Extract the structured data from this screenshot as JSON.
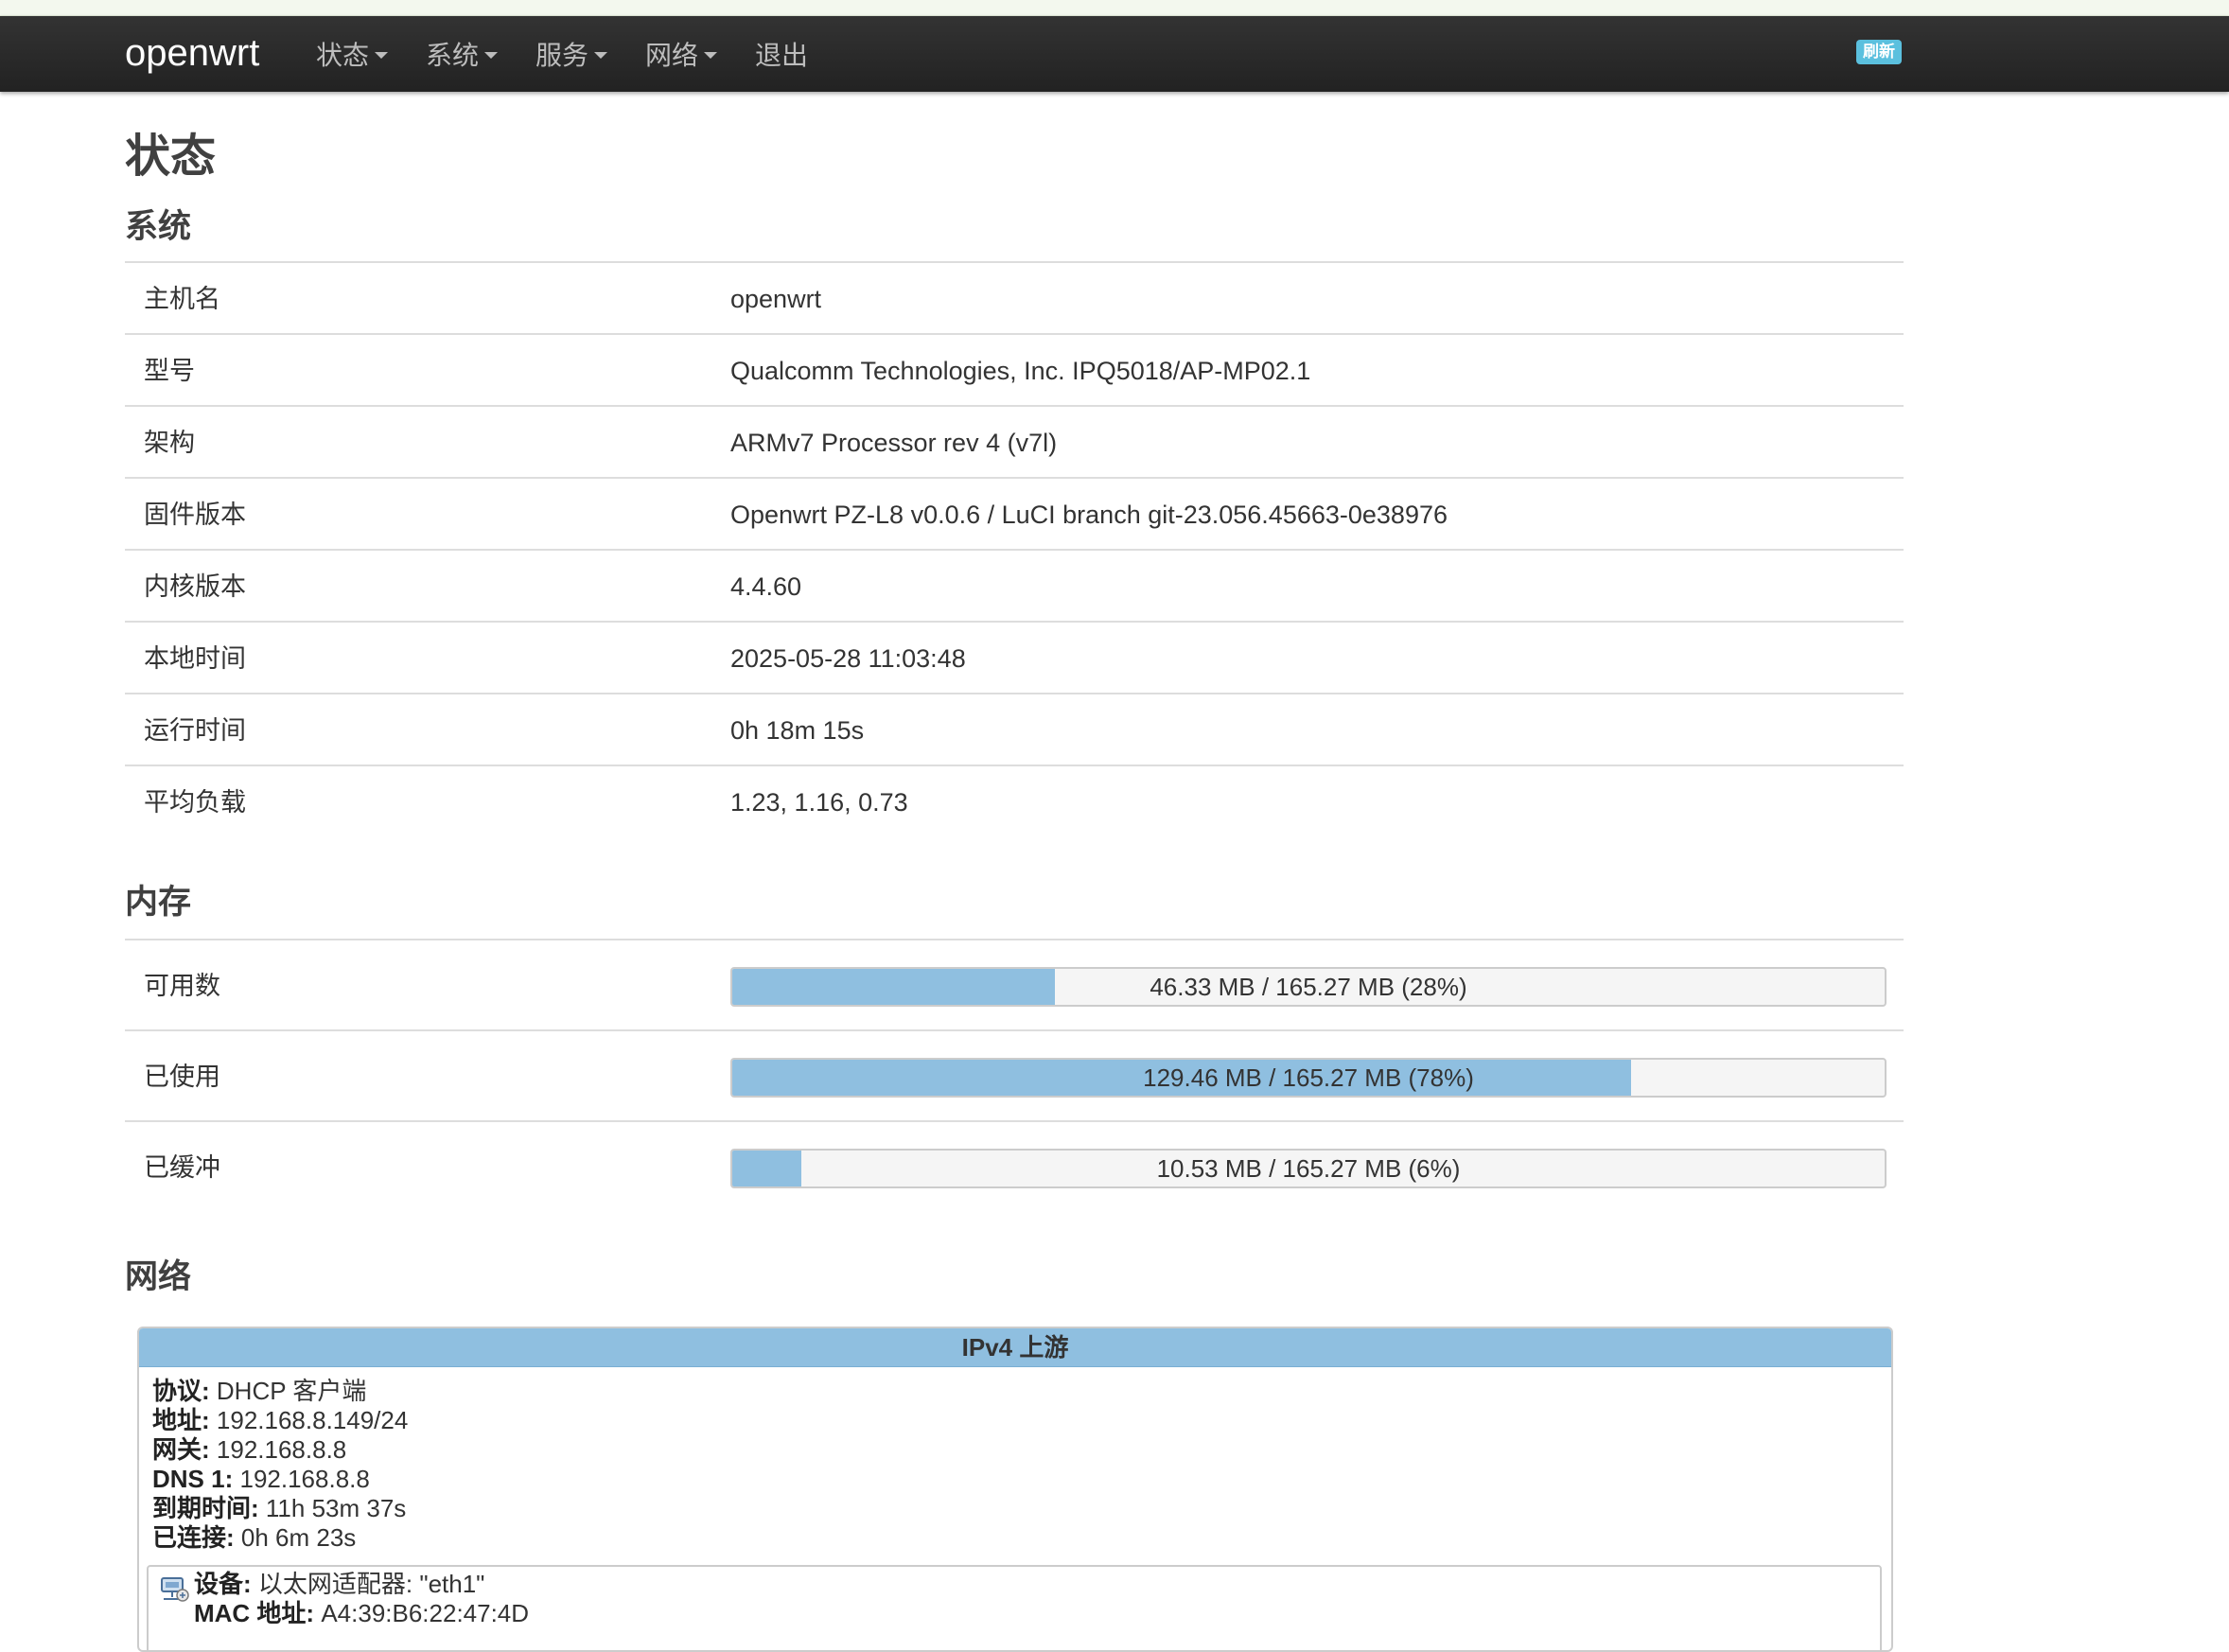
{
  "navbar": {
    "brand": "openwrt",
    "menu": [
      {
        "label": "状态",
        "dropdown": true
      },
      {
        "label": "系统",
        "dropdown": true
      },
      {
        "label": "服务",
        "dropdown": true
      },
      {
        "label": "网络",
        "dropdown": true
      },
      {
        "label": "退出",
        "dropdown": false
      }
    ],
    "refresh_label": "刷新"
  },
  "page": {
    "title": "状态"
  },
  "system": {
    "title": "系统",
    "rows": [
      {
        "label": "主机名",
        "value": "openwrt"
      },
      {
        "label": "型号",
        "value": "Qualcomm Technologies, Inc. IPQ5018/AP-MP02.1"
      },
      {
        "label": "架构",
        "value": "ARMv7 Processor rev 4 (v7l)"
      },
      {
        "label": "固件版本",
        "value": "Openwrt PZ-L8 v0.0.6 / LuCI branch git-23.056.45663-0e38976"
      },
      {
        "label": "内核版本",
        "value": "4.4.60"
      },
      {
        "label": "本地时间",
        "value": "2025-05-28 11:03:48"
      },
      {
        "label": "运行时间",
        "value": "0h 18m 15s"
      },
      {
        "label": "平均负载",
        "value": "1.23, 1.16, 0.73"
      }
    ]
  },
  "memory": {
    "title": "内存",
    "rows": [
      {
        "label": "可用数",
        "text": "46.33 MB / 165.27 MB (28%)",
        "percent": 28
      },
      {
        "label": "已使用",
        "text": "129.46 MB / 165.27 MB (78%)",
        "percent": 78
      },
      {
        "label": "已缓冲",
        "text": "10.53 MB / 165.27 MB (6%)",
        "percent": 6
      }
    ]
  },
  "network": {
    "title": "网络",
    "ipv4_header": "IPv4 上游",
    "fields": [
      {
        "key": "协议:",
        "value": "DHCP 客户端"
      },
      {
        "key": "地址:",
        "value": "192.168.8.149/24"
      },
      {
        "key": "网关:",
        "value": "192.168.8.8"
      },
      {
        "key": "DNS 1:",
        "value": "192.168.8.8"
      },
      {
        "key": "到期时间:",
        "value": "11h 53m 37s"
      },
      {
        "key": "已连接:",
        "value": "0h 6m 23s"
      }
    ],
    "device": {
      "icon": "ethernet-adapter-icon",
      "fields": [
        {
          "key": "设备:",
          "value": "以太网适配器: \"eth1\""
        },
        {
          "key": "MAC 地址:",
          "value": "A4:39:B6:22:47:4D"
        }
      ]
    }
  },
  "colors": {
    "navbar": "#222222",
    "accent_bar": "#8fbfe0",
    "refresh_badge": "#5bc0de"
  }
}
